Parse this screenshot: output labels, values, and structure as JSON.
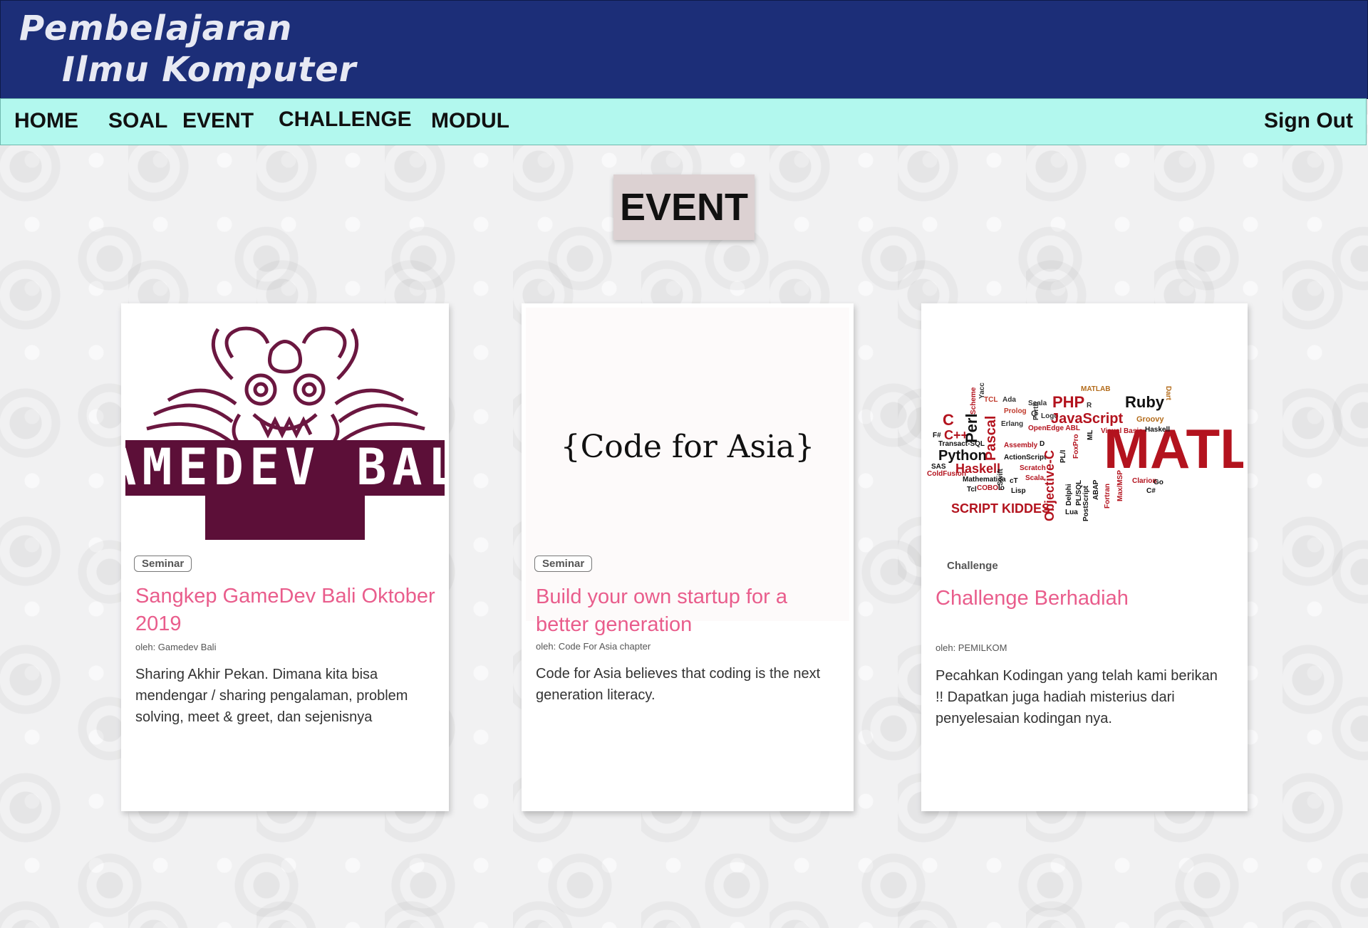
{
  "header": {
    "brand_line1": "Pembelajaran",
    "brand_line2": "Ilmu Komputer",
    "bg_color": "#1c2e78"
  },
  "nav": {
    "items": [
      "HOME",
      "SOAL",
      "EVENT",
      "CHALLENGE",
      "MODUL"
    ],
    "signout": "Sign Out",
    "bg_color": "#b2f8ee"
  },
  "page": {
    "heading": "EVENT"
  },
  "cards": [
    {
      "image_label": "GAMEDEV BALI",
      "image_icon": "barong-mask-logo",
      "badge": "Seminar",
      "title": "Sangkep GameDev Bali Oktober 2019",
      "author": "oleh: Gamedev Bali",
      "description": "Sharing Akhir Pekan. Dimana kita bisa mendengar / sharing pengalaman, problem solving, meet & greet, dan sejenisnya"
    },
    {
      "image_label": "{Code for Asia}",
      "badge": "Seminar",
      "title": "Build your own startup for a better generation",
      "author": "oleh: Code For Asia chapter",
      "description": "Code for Asia believes that coding is the next generation literacy."
    },
    {
      "image_label": "Java",
      "image_icon": "programming-languages-word-cloud",
      "word_cloud": [
        "MATLAB",
        "Dart",
        "TCL",
        "Ada",
        "Scala",
        "PHP",
        "Ruby",
        "Scheme",
        "Yacc",
        "Prolog",
        "Q",
        "Logo",
        "R",
        "JavaScript",
        "Groovy",
        "C",
        "C++",
        "Perl",
        "Erlang",
        "OpenEdge ABL",
        "Visual Basic",
        "Haskell",
        "F#",
        "Transact-SQL",
        "Assembly",
        "D",
        "ML",
        "Forth",
        "Python",
        "Pascal",
        "ActionScript",
        "SAS",
        "Haskell",
        "Scratch",
        "ColdFusion",
        "Swift",
        "Scala",
        "Mathematica",
        "cT",
        "Tcl",
        "COBOL",
        "Io",
        "Lisp",
        "SCRIPT KIDDES",
        "Objective-C",
        "Lua",
        "Delphi",
        "PL/SQL",
        "ABAP",
        "Fortran",
        "Max/MSP",
        "Clarion",
        "Go",
        "C#",
        "PostScript",
        "FoxPro",
        "PL/I"
      ],
      "badge": "Challenge",
      "title": "Challenge Berhadiah",
      "author": "oleh: PEMILKOM",
      "description": "Pecahkan Kodingan yang telah kami berikan !! Dapatkan juga hadiah misterius dari penyelesaian kodingan nya."
    }
  ]
}
